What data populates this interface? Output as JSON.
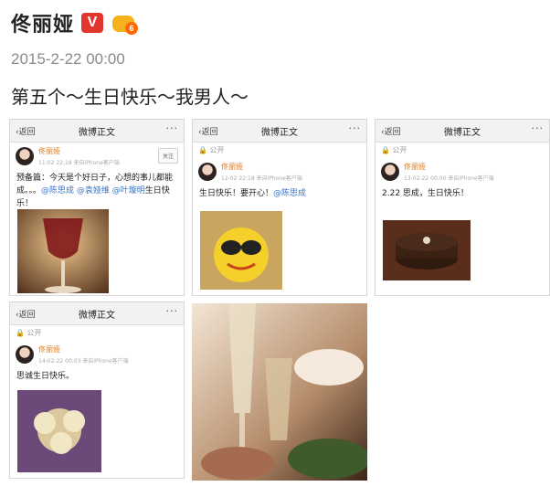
{
  "post": {
    "author": "佟丽娅",
    "verified_badge": "V",
    "member_level": "6",
    "timestamp": "2015-2-22 00:00",
    "text": "第五个～生日快乐～我男人～"
  },
  "screenshots": [
    {
      "back": "返回",
      "title": "微博正文",
      "more": "···",
      "name": "佟丽娅",
      "meta": "11-02 22:18 来自iPhone客户端",
      "action": "关注",
      "text_prefix": "预备篇：今天是个好日子，心想的事儿都能成。。。",
      "mentions": "@陈思成 @袁娅维 @叶璇明",
      "text_suffix": "生日快乐！"
    },
    {
      "back": "返回",
      "title": "微博正文",
      "more": "···",
      "public": "公开",
      "name": "佟丽娅",
      "meta": "12-02 22:18 来自iPhone客户端",
      "text_prefix": "生日快乐！要开心！",
      "mentions": "@陈思成"
    },
    {
      "back": "返回",
      "title": "微博正文",
      "more": "···",
      "public": "公开",
      "name": "佟丽娅",
      "meta": "13-02-22 00:00 来自iPhone客户端",
      "text": "2.22 思成，生日快乐！"
    },
    {
      "back": "返回",
      "title": "微博正文",
      "more": "···",
      "public": "公开",
      "name": "佟丽娅",
      "meta": "14-02-22 00:03 来自iPhone客户端",
      "text": "思诚生日快乐。"
    }
  ],
  "icons": {
    "back": "chevron-left-icon",
    "more": "more-dots-icon",
    "lock": "lock-icon",
    "crown": "crown-icon"
  },
  "colors": {
    "verified_red": "#e2372f",
    "crown_gold": "#f5b21c",
    "mention_blue": "#3a75c4",
    "name_orange": "#e07a1f"
  }
}
